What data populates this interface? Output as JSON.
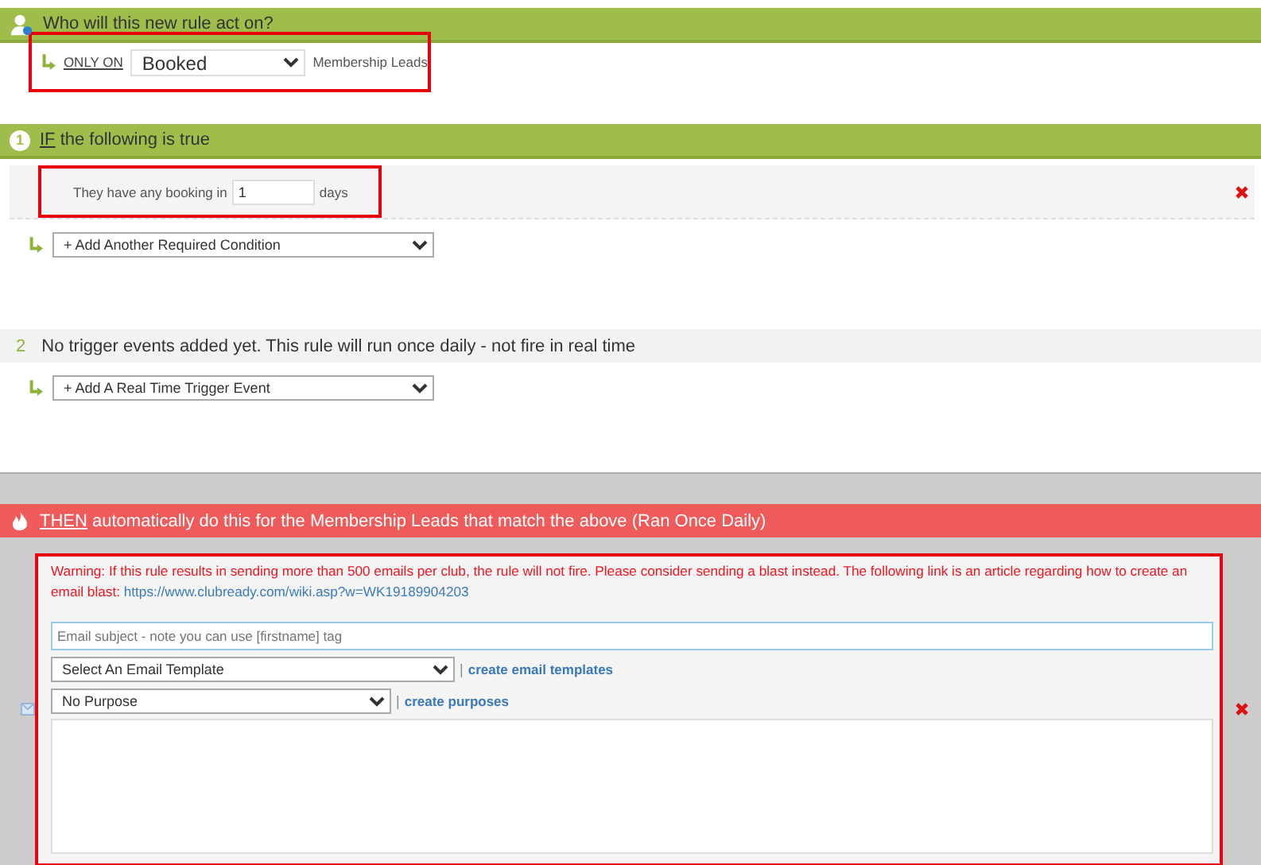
{
  "who": {
    "title": "Who will this new rule act on?",
    "only_on": "ONLY ON",
    "status_select": "Booked",
    "target": "Membership Leads"
  },
  "if_section": {
    "number": "1",
    "keyword": "IF",
    "title": "the following is true",
    "condition": {
      "before": "They have any booking in",
      "value": "1",
      "after": "days"
    },
    "add_select": "+ Add Another Required Condition"
  },
  "trigger_section": {
    "number": "2",
    "title": "No trigger events added yet. This rule will run once daily - not fire in real time",
    "add_select": "+ Add A Real Time Trigger Event"
  },
  "then_section": {
    "keyword": "THEN",
    "title": "automatically do this for the Membership Leads that match the above (Ran Once Daily)",
    "warning": "Warning: If this rule results in sending more than 500 emails per club, the rule will not fire. Please consider sending a blast instead. The following link is an article regarding how to create an email blast:",
    "link": "https://www.clubready.com/wiki.asp?w=WK19189904203",
    "subject_placeholder": "Email subject - note you can use [firstname] tag",
    "template_select": "Select An Email Template",
    "template_separator": "|",
    "template_link": "create email templates",
    "purpose_select": "No Purpose",
    "purpose_separator": "|",
    "purpose_link": "create purposes"
  }
}
